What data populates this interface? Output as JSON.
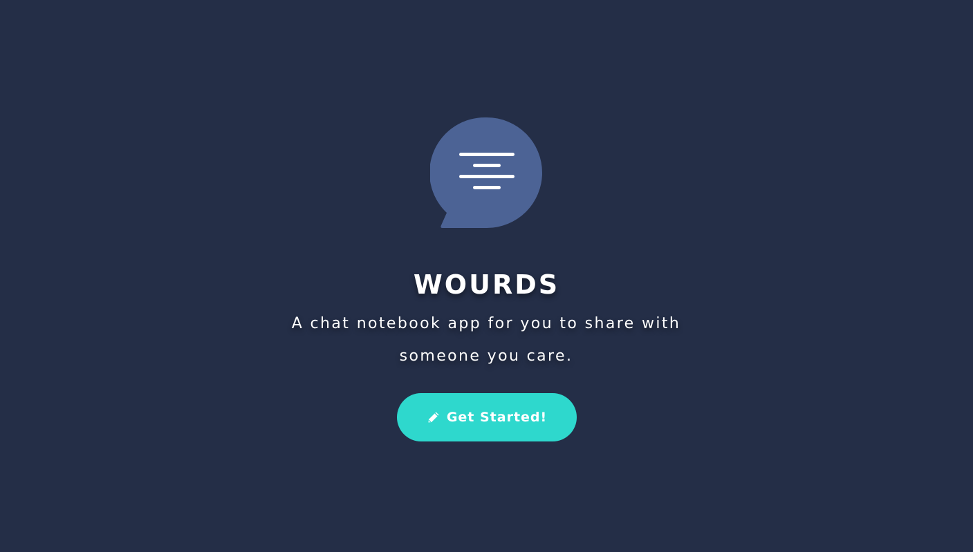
{
  "app": {
    "title": "WOURDS",
    "tagline": "A chat notebook app for you to share with someone you care.",
    "logo_icon": "chat-bubble-icon",
    "colors": {
      "background": "#242e47",
      "logo_bubble": "#4c6395",
      "button": "#2ed8cd",
      "text": "#ffffff"
    }
  },
  "cta": {
    "label": "Get Started!",
    "icon": "pencil-icon"
  }
}
